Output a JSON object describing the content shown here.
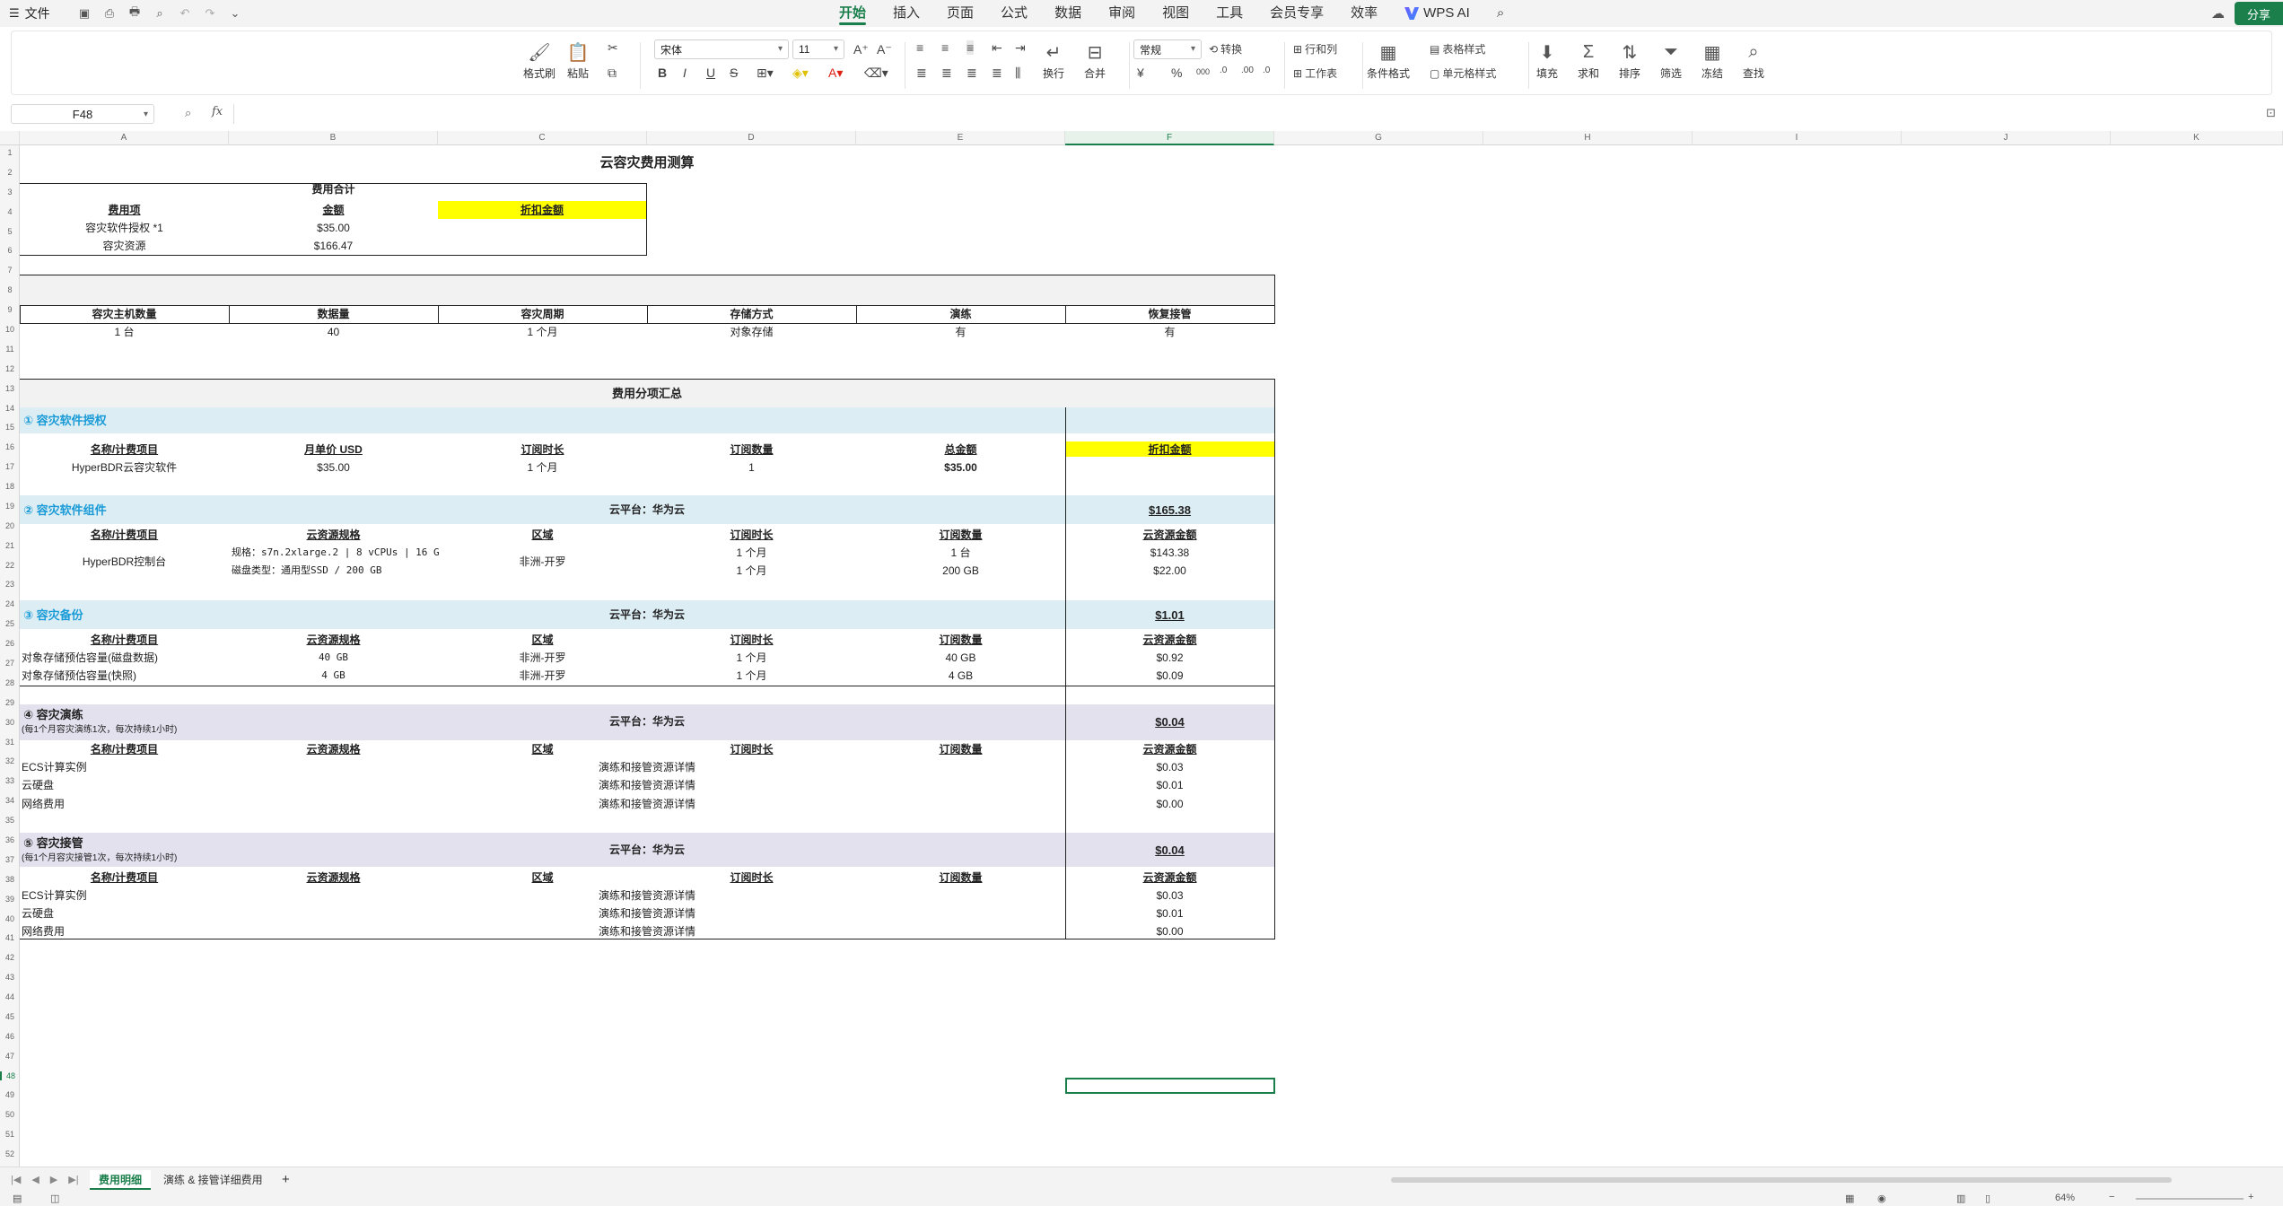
{
  "topbar": {
    "file_label": "文件",
    "tabs": [
      "开始",
      "插入",
      "页面",
      "公式",
      "数据",
      "审阅",
      "视图",
      "工具",
      "会员专享",
      "效率"
    ],
    "wps_ai": "WPS AI",
    "share": "分享"
  },
  "ribbon": {
    "format_painter": "格式刷",
    "paste": "粘贴",
    "font_name": "宋体",
    "font_size": "11",
    "wrap": "换行",
    "merge": "合并",
    "number_format": "常规",
    "convert": "转换",
    "rows_cols": "行和列",
    "worksheet": "工作表",
    "cond_format": "条件格式",
    "table_style": "表格样式",
    "cell_style": "单元格样式",
    "fill": "填充",
    "sum": "求和",
    "sort": "排序",
    "filter": "筛选",
    "freeze": "冻结",
    "find": "查找",
    "currency_symbol": "¥",
    "percent_symbol": "%",
    "thousands": "000"
  },
  "formula_bar": {
    "name_box": "F48",
    "fx": "fx",
    "value": ""
  },
  "columns": [
    "A",
    "B",
    "C",
    "D",
    "E",
    "F",
    "G",
    "H",
    "I",
    "J",
    "K"
  ],
  "selected_column": "F",
  "rows_count": 52,
  "selected_row": 48,
  "sheet": {
    "title": "云容灾费用测算",
    "summary": {
      "title": "费用合计",
      "h_item": "费用项",
      "h_amount": "金额",
      "h_discount": "折扣金额",
      "r1_item": "容灾软件授权 *1",
      "r1_amount": "$35.00",
      "r2_item": "容灾资源",
      "r2_amount": "$166.47"
    },
    "params": {
      "headers": [
        "容灾主机数量",
        "数据量",
        "容灾周期",
        "存储方式",
        "演练",
        "恢复接管"
      ],
      "values": [
        "1 台",
        "40",
        "1 个月",
        "对象存储",
        "有",
        "有"
      ]
    },
    "breakdown_title": "费用分项汇总",
    "s1": {
      "title": "① 容灾软件授权",
      "headers": [
        "名称/计费项目",
        "月单价 USD",
        "订阅时长",
        "订阅数量",
        "总金额"
      ],
      "discount": "折扣金额",
      "row": [
        "HyperBDR云容灾软件",
        "$35.00",
        "1 个月",
        "1",
        "$35.00"
      ]
    },
    "s2": {
      "title": "② 容灾软件组件",
      "platform": "云平台：华为云",
      "total": "$165.38",
      "headers": [
        "名称/计费项目",
        "云资源规格",
        "区域",
        "订阅时长",
        "订阅数量",
        "云资源金额"
      ],
      "name": "HyperBDR控制台",
      "region": "非洲-开罗",
      "spec1": "规格：s7n.2xlarge.2 | 8 vCPUs | 16 G",
      "dur1": "1 个月",
      "qty1": "1 台",
      "amt1": "$143.38",
      "spec2": "磁盘类型：通用型SSD / 200 GB",
      "dur2": "1 个月",
      "qty2": "200 GB",
      "amt2": "$22.00"
    },
    "s3": {
      "title": "③  容灾备份",
      "platform": "云平台：华为云",
      "total": "$1.01",
      "headers": [
        "名称/计费项目",
        "云资源规格",
        "区域",
        "订阅时长",
        "订阅数量",
        "云资源金额"
      ],
      "rows": [
        [
          "对象存储预估容量(磁盘数据)",
          "40 GB",
          "非洲-开罗",
          "1 个月",
          "40 GB",
          "$0.92"
        ],
        [
          "对象存储预估容量(快照)",
          "4 GB",
          "非洲-开罗",
          "1 个月",
          "4 GB",
          "$0.09"
        ]
      ]
    },
    "s4": {
      "title": "④  容灾演练",
      "note": "(每1个月容灾演练1次，每次持续1小时)",
      "platform": "云平台：华为云",
      "total": "$0.04",
      "headers": [
        "名称/计费项目",
        "云资源规格",
        "区域",
        "订阅时长",
        "订阅数量",
        "云资源金额"
      ],
      "detail": "演练和接管资源详情",
      "rows": [
        [
          "ECS计算实例",
          "$0.03"
        ],
        [
          "云硬盘",
          "$0.01"
        ],
        [
          "网络费用",
          "$0.00"
        ]
      ]
    },
    "s5": {
      "title": "⑤ 容灾接管",
      "note": "(每1个月容灾接管1次，每次持续1小时)",
      "platform": "云平台：华为云",
      "total": "$0.04",
      "headers": [
        "名称/计费项目",
        "云资源规格",
        "区域",
        "订阅时长",
        "订阅数量",
        "云资源金额"
      ],
      "detail": "演练和接管资源详情",
      "rows": [
        [
          "ECS计算实例",
          "$0.03"
        ],
        [
          "云硬盘",
          "$0.01"
        ],
        [
          "网络费用",
          "$0.00"
        ]
      ]
    }
  },
  "sheet_tabs": [
    "费用明细",
    "演练 & 接管详细费用"
  ],
  "active_sheet": "费用明细",
  "status": {
    "zoom": "64%"
  },
  "colors": {
    "accent": "#1a7f4b",
    "yellow": "#ffff00",
    "section_blue": "#dcedf4",
    "section_purple": "#e4e1ef",
    "grey_band": "#f2f2f2",
    "title_blue": "#1a9bd7"
  }
}
